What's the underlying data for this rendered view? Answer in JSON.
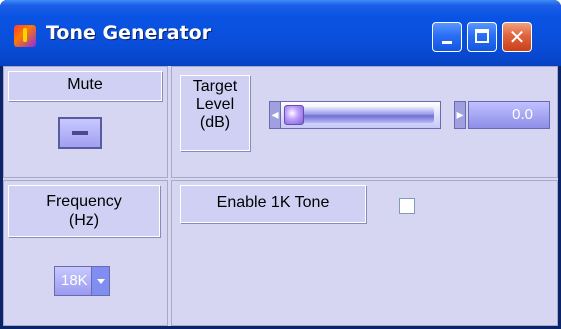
{
  "window": {
    "title": "Tone Generator",
    "close_glyph": "✕",
    "colors": {
      "titlebar": "#0a4fdc",
      "close": "#e0643e",
      "panel": "#d6d6f2"
    }
  },
  "mute": {
    "label": "Mute",
    "state": "off"
  },
  "target_level": {
    "label_line1": "Target",
    "label_line2": "Level",
    "label_line3": "(dB)",
    "value": "0.0"
  },
  "frequency": {
    "label_line1": "Frequency",
    "label_line2": "(Hz)",
    "selected": "18K"
  },
  "enable_1k": {
    "label": "Enable 1K Tone",
    "checked": false
  },
  "icons": [
    "app-icon",
    "minimize-icon",
    "maximize-icon",
    "close-icon",
    "chevron-down-icon",
    "arrow-left-icon",
    "arrow-right-icon"
  ]
}
